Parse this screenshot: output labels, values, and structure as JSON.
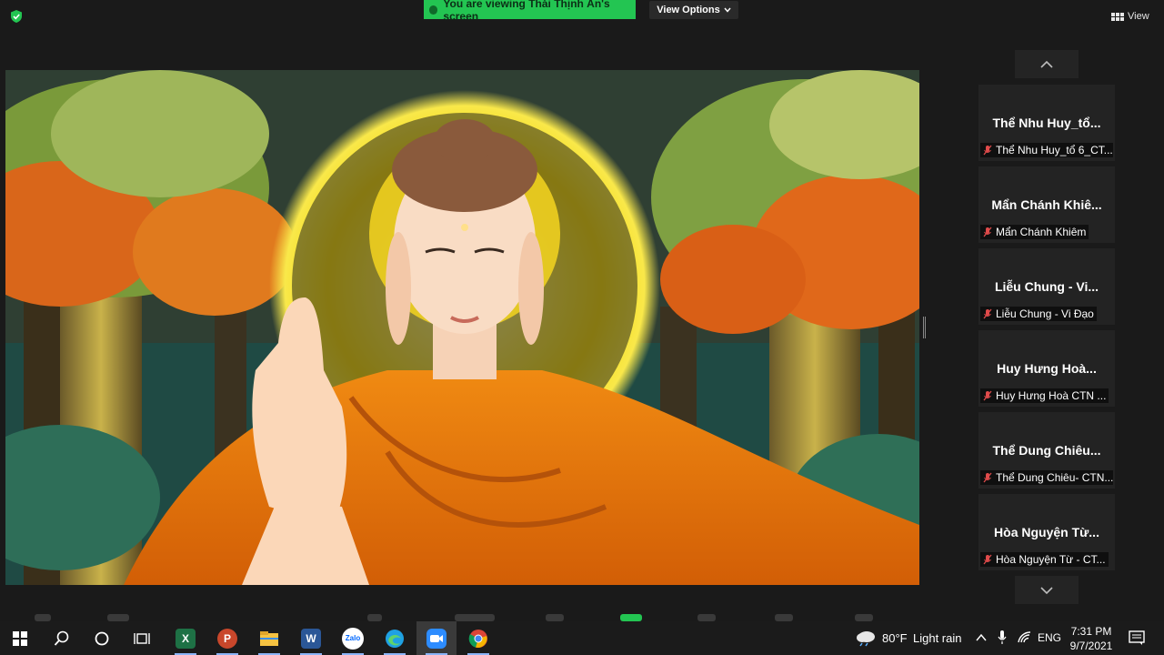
{
  "banner": {
    "text": "You are viewing Thái Thịnh Ân's screen"
  },
  "view_options": {
    "label": "View Options"
  },
  "view": {
    "label": "View"
  },
  "participants": [
    {
      "name": "Thể Nhu Huy_tổ...",
      "label": "Thể Nhu Huy_tổ 6_CT..."
    },
    {
      "name": "Mẩn Chánh Khiê...",
      "label": "Mẩn Chánh Khiêm"
    },
    {
      "name": "Liễu Chung - Vi...",
      "label": "Liễu Chung - Vi Đạo"
    },
    {
      "name": "Huy Hưng Hoà...",
      "label": "Huy Hưng Hoà CTN ..."
    },
    {
      "name": "Thể Dung Chiêu...",
      "label": "Thể Dung Chiêu- CTN..."
    },
    {
      "name": "Hòa Nguyện Từ...",
      "label": "Hòa Nguyện Từ - CT..."
    }
  ],
  "taskbar": {
    "apps": [
      "start-icon",
      "search-icon",
      "cortana-icon",
      "task-view-icon",
      "excel-icon",
      "powerpoint-icon",
      "file-explorer-icon",
      "word-icon",
      "zalo-icon",
      "edge-icon",
      "zoom-icon",
      "chrome-icon"
    ],
    "excel_letter": "X",
    "powerpoint_letter": "P",
    "word_letter": "W",
    "zalo_text": "Zalo"
  },
  "weather": {
    "temp": "80°F",
    "condition": "Light rain"
  },
  "tray": {
    "language": "ENG"
  },
  "clock": {
    "time": "7:31 PM",
    "date": "9/7/2021"
  },
  "colors": {
    "banner_green": "#23c552",
    "background": "#1a1a1a",
    "tile": "#232323",
    "robe": "#e8740c",
    "halo": "#f5d70a"
  }
}
